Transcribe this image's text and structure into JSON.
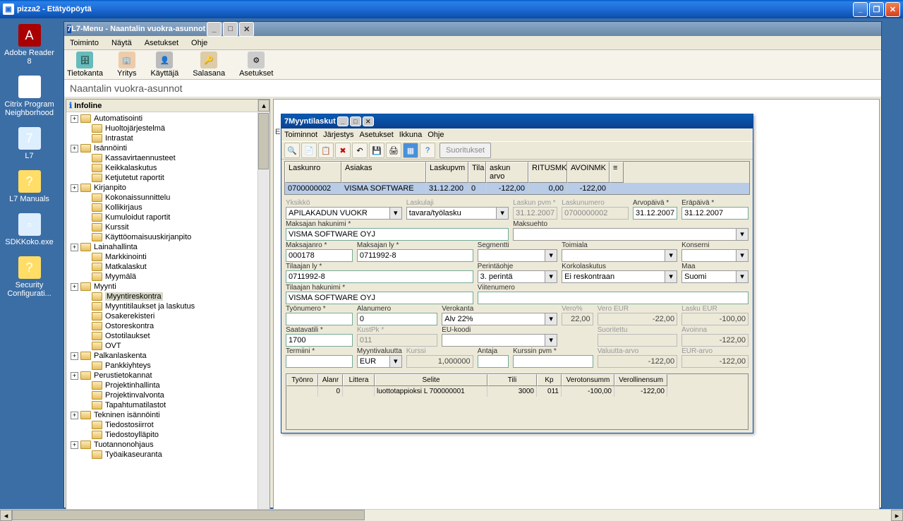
{
  "remote": {
    "title": "pizza2 - Etätyöpöytä"
  },
  "desktop_icons": [
    {
      "label": "Adobe Reader 8",
      "glyph": "A",
      "bg": "#a00"
    },
    {
      "label": "Citrix Program Neighborhood",
      "glyph": "●",
      "bg": "#fff"
    },
    {
      "label": "L7",
      "glyph": "7",
      "bg": "#ddeeff"
    },
    {
      "label": "L7 Manuals",
      "glyph": "?",
      "bg": "#ffdd66"
    },
    {
      "label": "SDKKoko.exe",
      "glyph": "▫",
      "bg": "#ddeeff"
    },
    {
      "label": "Security Configurati...",
      "glyph": "?",
      "bg": "#ffdd66"
    }
  ],
  "l7": {
    "title": "L7-Menu - Naantalin vuokra-asunnot",
    "menu": [
      "Toiminto",
      "Näytä",
      "Asetukset",
      "Ohje"
    ],
    "toolbar": [
      {
        "label": "Tietokanta",
        "glyph": "🗄",
        "bg": "#6bb"
      },
      {
        "label": "Yritys",
        "glyph": "🏢",
        "bg": "#eca"
      },
      {
        "label": "Käyttäjä",
        "glyph": "👤",
        "bg": "#bbb"
      },
      {
        "label": "Salasana",
        "glyph": "🔑",
        "bg": "#dca"
      },
      {
        "label": "Asetukset",
        "glyph": "⚙",
        "bg": "#ccc"
      }
    ],
    "heading": "Naantalin vuokra-asunnot",
    "tree_head": "Infoline",
    "tree": [
      {
        "t": "p",
        "e": "+",
        "l": "Automatisointi"
      },
      {
        "t": "c",
        "l": "Huoltojärjestelmä"
      },
      {
        "t": "c",
        "l": "Intrastat"
      },
      {
        "t": "p",
        "e": "+",
        "l": "Isännöinti"
      },
      {
        "t": "c",
        "l": "Kassavirtaennusteet"
      },
      {
        "t": "c",
        "l": "Keikkalaskutus"
      },
      {
        "t": "c",
        "l": "Ketjutetut raportit"
      },
      {
        "t": "p",
        "e": "+",
        "l": "Kirjanpito"
      },
      {
        "t": "c",
        "l": "Kokonaissunnittelu"
      },
      {
        "t": "c",
        "l": "Kollikirjaus"
      },
      {
        "t": "c",
        "l": "Kumuloidut raportit"
      },
      {
        "t": "c",
        "l": "Kurssit"
      },
      {
        "t": "c",
        "l": "Käyttöomaisuuskirjanpito"
      },
      {
        "t": "p",
        "e": "+",
        "l": "Lainahallinta"
      },
      {
        "t": "c",
        "l": "Markkinointi"
      },
      {
        "t": "c",
        "l": "Matkalaskut"
      },
      {
        "t": "c",
        "l": "Myymälä"
      },
      {
        "t": "p",
        "e": "+",
        "l": "Myynti"
      },
      {
        "t": "c",
        "l": "Myyntireskontra",
        "sel": true
      },
      {
        "t": "c",
        "l": "Myyntitilaukset ja laskutus"
      },
      {
        "t": "c",
        "l": "Osakerekisteri"
      },
      {
        "t": "c",
        "l": "Ostoreskontra"
      },
      {
        "t": "c",
        "l": "Ostotilaukset"
      },
      {
        "t": "c",
        "l": "OVT"
      },
      {
        "t": "p",
        "e": "+",
        "l": "Palkanlaskenta"
      },
      {
        "t": "c",
        "l": "Pankkiyhteys"
      },
      {
        "t": "p",
        "e": "+",
        "l": "Perustietokannat"
      },
      {
        "t": "c",
        "l": "Projektinhallinta"
      },
      {
        "t": "c",
        "l": "Projektinvalvonta"
      },
      {
        "t": "c",
        "l": "Tapahtumatilastot"
      },
      {
        "t": "p",
        "e": "+",
        "l": "Tekninen isännöinti"
      },
      {
        "t": "c",
        "l": "Tiedostosiirrot"
      },
      {
        "t": "c",
        "l": "Tiedostoylläpito"
      },
      {
        "t": "p",
        "e": "+",
        "l": "Tuotannonohjaus"
      },
      {
        "t": "c",
        "l": "Työaikaseuranta"
      }
    ],
    "en_label": "En"
  },
  "dlg": {
    "title": "Myyntilaskut",
    "menu": [
      "Toiminnot",
      "Järjestys",
      "Asetukset",
      "Ikkuna",
      "Ohje"
    ],
    "suoritukset": "Suoritukset",
    "grid": {
      "cols": [
        {
          "l": "Laskunro",
          "w": 80
        },
        {
          "l": "Asiakas",
          "w": 120
        },
        {
          "l": "Laskupvm",
          "w": 60
        },
        {
          "l": "Tila",
          "w": 25
        },
        {
          "l": "askun arvo",
          "w": 60
        },
        {
          "l": "RITUSMK",
          "w": 55
        },
        {
          "l": "AVOINMK",
          "w": 60
        }
      ],
      "row": [
        "0700000002",
        "VISMA SOFTWARE",
        "31.12.200",
        "0",
        "-122,00",
        "0,00",
        "-122,00"
      ]
    },
    "fields": {
      "yksikko": {
        "label": "Yksikkö",
        "val": "APILAKADUN VUOKR"
      },
      "laskulaji": {
        "label": "Laskulaji",
        "val": "tavara/työlasku"
      },
      "laskunpvm": {
        "label": "Laskun pvm *",
        "val": "31.12.2007"
      },
      "laskunumero": {
        "label": "Laskunumero",
        "val": "0700000002"
      },
      "arvopv": {
        "label": "Arvopäivä *",
        "val": "31.12.2007"
      },
      "erapv": {
        "label": "Eräpäivä *",
        "val": "31.12.2007"
      },
      "maksajanhaku": {
        "label": "Maksajan hakunimi *",
        "val": "VISMA SOFTWARE OYJ"
      },
      "maksuehto": {
        "label": "Maksuehto",
        "val": ""
      },
      "maksajanro": {
        "label": "Maksajanro *",
        "val": "000178"
      },
      "maksajanly": {
        "label": "Maksajan ly *",
        "val": "0711992-8"
      },
      "segmentti": {
        "label": "Segmentti",
        "val": ""
      },
      "toimiala": {
        "label": "Toimiala",
        "val": ""
      },
      "konserni": {
        "label": "Konserni",
        "val": ""
      },
      "tilaajanly": {
        "label": "Tilaajan ly *",
        "val": "0711992-8"
      },
      "perintaohje": {
        "label": "Perintäohje",
        "val": "3. perintä"
      },
      "korkolaskutus": {
        "label": "Korkolaskutus",
        "val": "Ei reskontraan"
      },
      "maa": {
        "label": "Maa",
        "val": "Suomi"
      },
      "tilaajanhaku": {
        "label": "Tilaajan hakunimi *",
        "val": "VISMA SOFTWARE OYJ"
      },
      "viitenumero": {
        "label": "Viitenumero",
        "val": ""
      },
      "tyonumero": {
        "label": "Työnumero *",
        "val": ""
      },
      "alanumero": {
        "label": "Alanumero",
        "val": "0"
      },
      "verokanta": {
        "label": "Verokanta",
        "val": "Alv 22%"
      },
      "veropct": {
        "label": "Vero%",
        "val": "22,00"
      },
      "veroeur": {
        "label": "Vero EUR",
        "val": "-22,00"
      },
      "laskueur": {
        "label": "Lasku EUR",
        "val": "-100,00"
      },
      "saatavatili": {
        "label": "Saatavatili *",
        "val": "1700"
      },
      "kustpk": {
        "label": "KustPk *",
        "val": "011"
      },
      "eukoodi": {
        "label": "EU-koodi",
        "val": ""
      },
      "suoritettu": {
        "label": "Suoritettu",
        "val": ""
      },
      "avoinna": {
        "label": "Avoinna",
        "val": "-122,00"
      },
      "termiini": {
        "label": "Termiini *",
        "val": ""
      },
      "myyntival": {
        "label": "Myyntivaluutta",
        "val": "EUR"
      },
      "kurssi": {
        "label": "Kurssi",
        "val": "1,000000"
      },
      "antaja": {
        "label": "Antaja",
        "val": ""
      },
      "kurssinpvm": {
        "label": "Kurssin pvm *",
        "val": ""
      },
      "valuuttaarvo": {
        "label": "Valuutta-arvo",
        "val": "-122,00"
      },
      "eurarvo": {
        "label": "EUR-arvo",
        "val": "-122,00"
      }
    },
    "detail": {
      "cols": [
        {
          "l": "Työnro",
          "w": 45
        },
        {
          "l": "Alanr",
          "w": 35
        },
        {
          "l": "Littera",
          "w": 45
        },
        {
          "l": "Selite",
          "w": 160
        },
        {
          "l": "Tili",
          "w": 70
        },
        {
          "l": "Kp",
          "w": 35
        },
        {
          "l": "Verotonsumm",
          "w": 75
        },
        {
          "l": "Verollinensum",
          "w": 75
        }
      ],
      "row": [
        "",
        "0",
        "",
        "luottotappioksi L 700000001",
        "3000",
        "011",
        "-100,00",
        "-122,00"
      ]
    }
  }
}
